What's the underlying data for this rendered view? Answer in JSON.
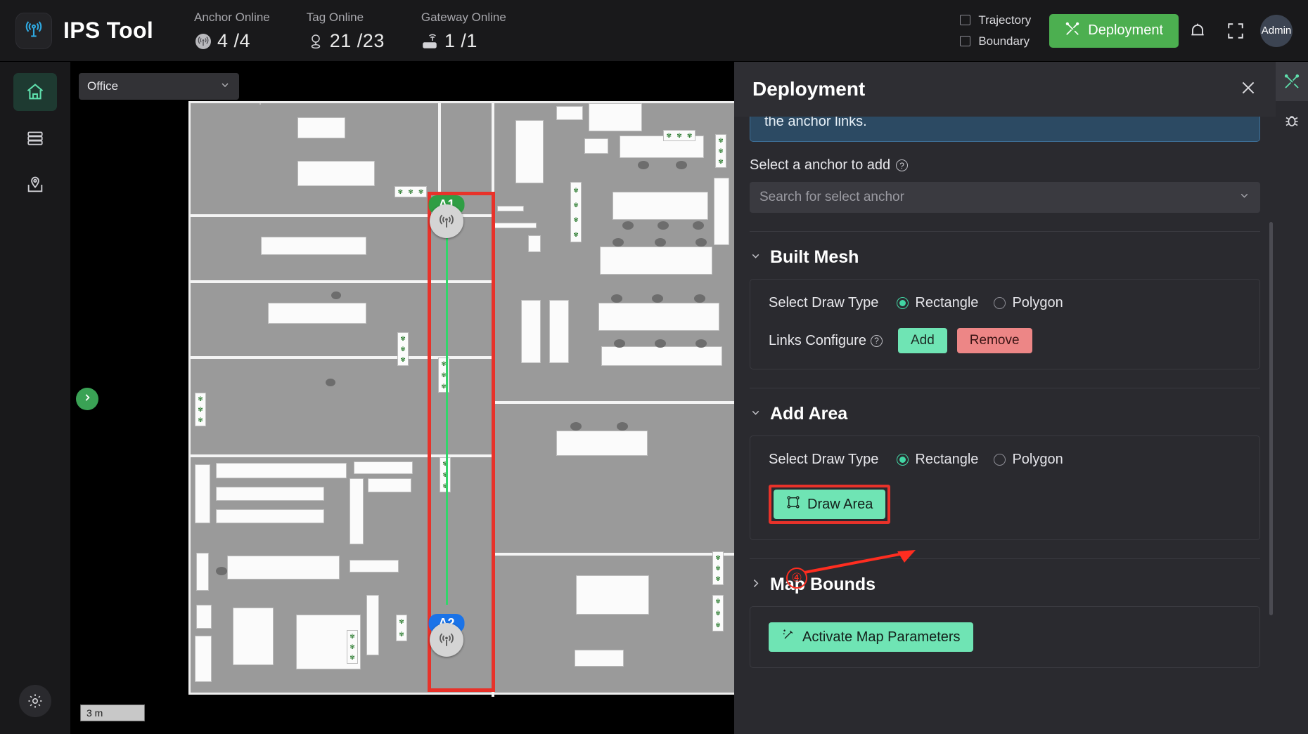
{
  "app": {
    "title": "IPS Tool",
    "logo_icon": "antenna-signal-icon"
  },
  "header": {
    "stats": [
      {
        "label": "Anchor Online",
        "value": "4 /4",
        "icon": "anchor-signal-icon"
      },
      {
        "label": "Tag Online",
        "value": "21 /23",
        "icon": "tag-pin-icon"
      },
      {
        "label": "Gateway Online",
        "value": "1 /1",
        "icon": "gateway-router-icon"
      }
    ],
    "checkboxes": [
      {
        "label": "Trajectory",
        "checked": false
      },
      {
        "label": "Boundary",
        "checked": false
      }
    ],
    "deploy_button": {
      "label": "Deployment",
      "icon": "tools-cross-icon",
      "color": "#4caf50"
    },
    "alarm_icon": "alarm-bell-icon",
    "fullscreen_icon": "fullscreen-icon",
    "user": {
      "name": "Admin"
    }
  },
  "sidebar": {
    "items": [
      {
        "name": "home",
        "icon": "home-icon",
        "active": true
      },
      {
        "name": "devices",
        "icon": "server-icon",
        "active": false
      },
      {
        "name": "maps",
        "icon": "map-pin-icon",
        "active": false
      }
    ],
    "settings": {
      "icon": "gear-icon"
    }
  },
  "map": {
    "floor_select": {
      "value": "Office",
      "chevron": "chevron-down-icon"
    },
    "scale_bar": {
      "label": "3 m"
    },
    "pan_button": {
      "icon": "chevron-right-icon"
    },
    "anchors": [
      {
        "id": "A1",
        "badge_color": "#2f9e44",
        "icon": "anchor-signal-icon"
      },
      {
        "id": "A2",
        "badge_color": "#1a73e8",
        "icon": "anchor-signal-icon"
      }
    ],
    "mesh_rect_color": "#e8322a",
    "link_line_color": "#32d66a"
  },
  "annotation": {
    "step_number": "④",
    "color": "#ff2d20"
  },
  "panel": {
    "title": "Deployment",
    "close_icon": "close-icon",
    "notice": "the anchor links.",
    "anchor_picker": {
      "label": "Select a anchor to add",
      "help_icon": "question-mark-icon",
      "placeholder": "Search for select anchor",
      "chevron": "chevron-down-icon"
    },
    "sections": [
      {
        "key": "built_mesh",
        "title": "Built Mesh",
        "caret": "chevron-down-icon",
        "expanded": true,
        "draw_type": {
          "label": "Select Draw Type",
          "options": [
            "Rectangle",
            "Polygon"
          ],
          "selected": "Rectangle"
        },
        "links_configure": {
          "label": "Links Configure",
          "help_icon": "question-mark-icon",
          "add_label": "Add",
          "remove_label": "Remove"
        }
      },
      {
        "key": "add_area",
        "title": "Add Area",
        "caret": "chevron-down-icon",
        "expanded": true,
        "draw_type": {
          "label": "Select Draw Type",
          "options": [
            "Rectangle",
            "Polygon"
          ],
          "selected": "Rectangle"
        },
        "draw_area_button": {
          "label": "Draw Area",
          "icon": "draw-rectangle-icon",
          "highlighted": true
        }
      },
      {
        "key": "map_bounds",
        "title": "Map Bounds",
        "caret": "chevron-right-icon",
        "expanded": false,
        "activate_button": {
          "label": "Activate Map Parameters",
          "icon": "magic-wand-icon"
        }
      }
    ]
  },
  "edge_toolbar": {
    "items": [
      {
        "name": "deployment-tools",
        "icon": "tools-cross-icon",
        "active": true
      },
      {
        "name": "debug",
        "icon": "bug-icon",
        "active": false
      }
    ]
  }
}
